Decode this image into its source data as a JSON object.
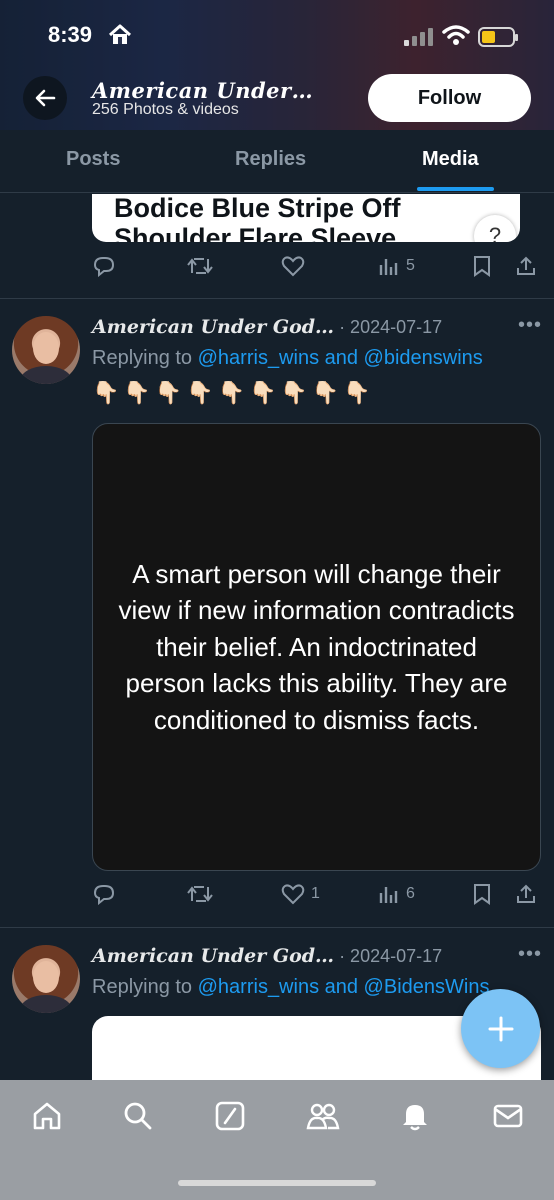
{
  "status_bar": {
    "time": "8:39"
  },
  "profile": {
    "name": "American Under…",
    "subtitle": "256 Photos & videos",
    "follow_label": "Follow"
  },
  "tabs": [
    {
      "label": "Posts",
      "active": false
    },
    {
      "label": "Replies",
      "active": false
    },
    {
      "label": "Media",
      "active": true
    }
  ],
  "tweets": [
    {
      "card_title_line1": "Bodice Blue Stripe Off",
      "card_title_line2": "Shoulder Flare Sleeve",
      "help_label": "?",
      "actions": {
        "replies": "",
        "retweets": "",
        "likes": "",
        "views": "5"
      }
    },
    {
      "author": "American Under God…",
      "date": "· 2024-07-17",
      "more": "•••",
      "replying_prefix": "Replying to ",
      "replying_mentions": "@harris_wins and @bidenswins",
      "emojis": "👇🏻👇🏻👇🏻👇🏻👇🏻👇🏻👇🏻👇🏻👇🏻",
      "image_text": "A smart person will change their view if new information contradicts their belief. An indoctrinated person lacks this ability. They are conditioned to dismiss facts.",
      "actions": {
        "replies": "",
        "retweets": "",
        "likes": "1",
        "views": "6"
      }
    },
    {
      "author": "American Under God…",
      "date": "· 2024-07-17",
      "more": "•••",
      "replying_prefix": "Replying to ",
      "replying_mentions": "@harris_wins and @BidensWins"
    }
  ],
  "colors": {
    "accent": "#1d9bf0",
    "background": "#15202b",
    "muted": "#8b98a5"
  }
}
